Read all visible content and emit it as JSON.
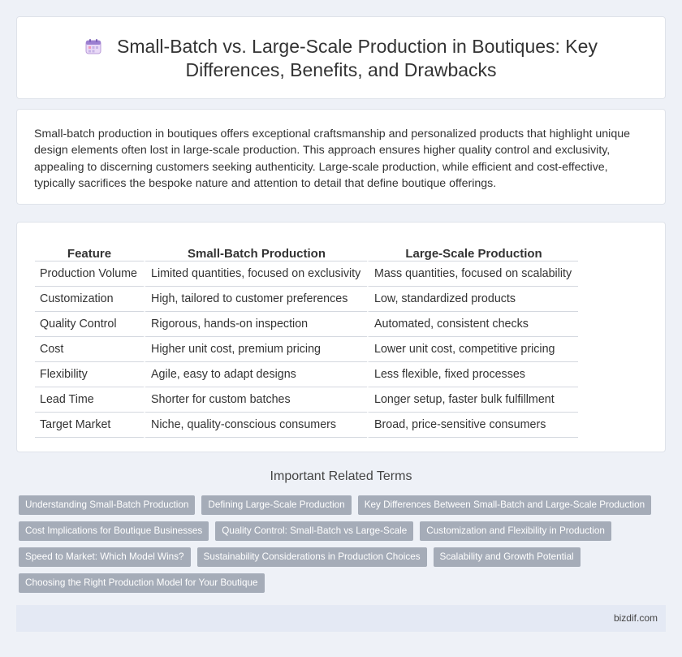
{
  "header": {
    "title": "Small-Batch vs. Large-Scale Production in Boutiques: Key Differences, Benefits, and Drawbacks",
    "icon": "calendar-icon"
  },
  "intro": {
    "text": "Small-batch production in boutiques offers exceptional craftsmanship and personalized products that highlight unique design elements often lost in large-scale production. This approach ensures higher quality control and exclusivity, appealing to discerning customers seeking authenticity. Large-scale production, while efficient and cost-effective, typically sacrifices the bespoke nature and attention to detail that define boutique offerings."
  },
  "table": {
    "headers": [
      "Feature",
      "Small-Batch Production",
      "Large-Scale Production"
    ],
    "rows": [
      [
        "Production Volume",
        "Limited quantities, focused on exclusivity",
        "Mass quantities, focused on scalability"
      ],
      [
        "Customization",
        "High, tailored to customer preferences",
        "Low, standardized products"
      ],
      [
        "Quality Control",
        "Rigorous, hands-on inspection",
        "Automated, consistent checks"
      ],
      [
        "Cost",
        "Higher unit cost, premium pricing",
        "Lower unit cost, competitive pricing"
      ],
      [
        "Flexibility",
        "Agile, easy to adapt designs",
        "Less flexible, fixed processes"
      ],
      [
        "Lead Time",
        "Shorter for custom batches",
        "Longer setup, faster bulk fulfillment"
      ],
      [
        "Target Market",
        "Niche, quality-conscious consumers",
        "Broad, price-sensitive consumers"
      ]
    ]
  },
  "related": {
    "title": "Important Related Terms",
    "tags": [
      "Understanding Small-Batch Production",
      "Defining Large-Scale Production",
      "Key Differences Between Small-Batch and Large-Scale Production",
      "Cost Implications for Boutique Businesses",
      "Quality Control: Small-Batch vs Large-Scale",
      "Customization and Flexibility in Production",
      "Speed to Market: Which Model Wins?",
      "Sustainability Considerations in Production Choices",
      "Scalability and Growth Potential",
      "Choosing the Right Production Model for Your Boutique"
    ]
  },
  "footer": {
    "site": "bizdif.com"
  },
  "colors": {
    "background": "#eef1f7",
    "tag_bg": "#a5acb8",
    "footer_bg": "#e4e9f4"
  }
}
